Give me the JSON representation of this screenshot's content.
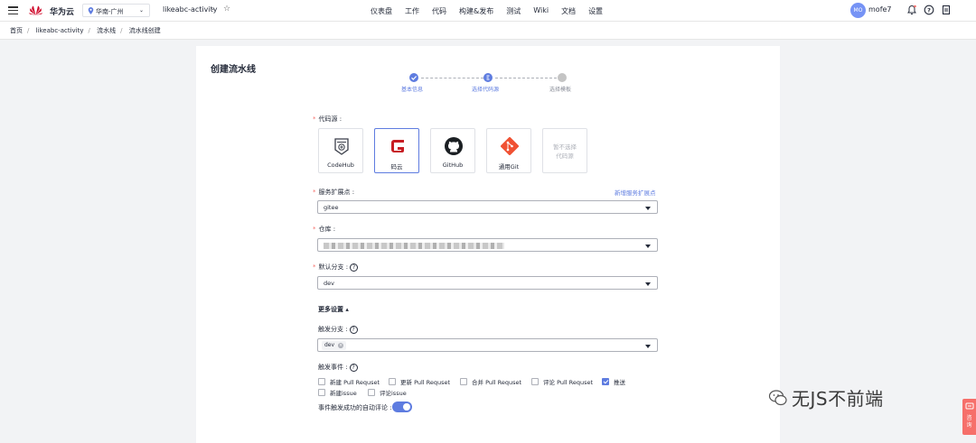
{
  "header": {
    "brand": "华为云",
    "region": "华南-广州",
    "project": "likeabc-activity",
    "nav": [
      "仪表盘",
      "工作",
      "代码",
      "构建&发布",
      "测试",
      "Wiki",
      "文档",
      "设置"
    ],
    "avatar_initials": "MO",
    "username": "mofe7"
  },
  "breadcrumb": [
    "首页",
    "likeabc-activity",
    "流水线",
    "流水线创建"
  ],
  "page": {
    "title": "创建流水线",
    "steps": [
      "基本信息",
      "选择代码源",
      "选择模板"
    ]
  },
  "form": {
    "source_label": "代码源 :",
    "sources": [
      "CodeHub",
      "码云",
      "GitHub",
      "通用Git"
    ],
    "disabled_source": [
      "暂不选择",
      "代码源"
    ],
    "endpoint_label": "服务扩展点 :",
    "endpoint_link": "新增服务扩展点",
    "endpoint_value": "gitee",
    "repo_label": "仓库 :",
    "branch_label": "默认分支 :",
    "branch_value": "dev",
    "more_settings": "更多设置 ▴",
    "trigger_branch_label": "触发分支 :",
    "trigger_branch_tag": "dev",
    "trigger_events_label": "触发事件 :",
    "events": [
      {
        "label": "新建 Pull Requset",
        "checked": false
      },
      {
        "label": "更新 Pull Requset",
        "checked": false
      },
      {
        "label": "合并 Pull Requset",
        "checked": false
      },
      {
        "label": "评论 Pull Requset",
        "checked": false
      },
      {
        "label": "推送",
        "checked": true
      },
      {
        "label": "新建issue",
        "checked": false
      },
      {
        "label": "评论issue",
        "checked": false
      }
    ],
    "auto_comment_label": "事件触发成功的自动评论 :",
    "auto_comment_on": true
  },
  "watermark": "无JS不前端",
  "side_button": "咨询",
  "colors": {
    "accent": "#5e7ce0",
    "required": "#f66f6a",
    "gitee": "#c71d23",
    "git": "#f05133"
  }
}
